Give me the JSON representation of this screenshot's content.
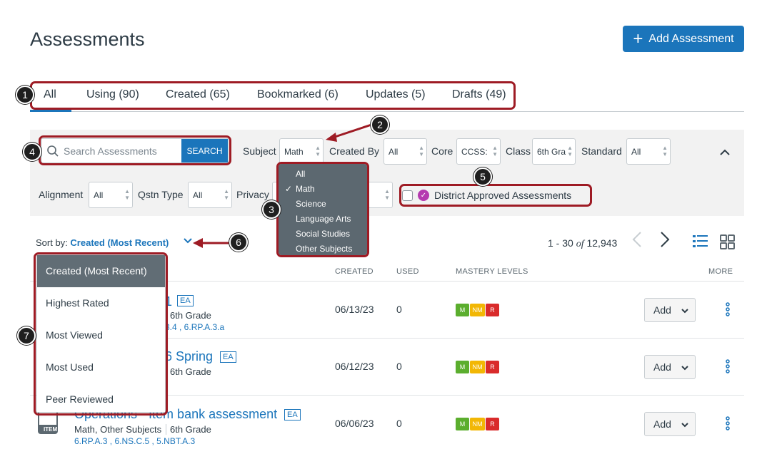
{
  "page": {
    "title": "Assessments",
    "add_button": "Add Assessment"
  },
  "tabs": [
    "All",
    "Using (90)",
    "Created (65)",
    "Bookmarked (6)",
    "Updates (5)",
    "Drafts (49)"
  ],
  "search": {
    "placeholder": "Search Assessments",
    "button": "SEARCH"
  },
  "filters": {
    "subject": {
      "label": "Subject",
      "value": "Math"
    },
    "created_by": {
      "label": "Created By",
      "value": "All"
    },
    "core": {
      "label": "Core",
      "value": "CCSS:"
    },
    "class": {
      "label": "Class",
      "value": "6th Gra"
    },
    "standard": {
      "label": "Standard",
      "value": "All"
    },
    "alignment": {
      "label": "Alignment",
      "value": "All"
    },
    "qstn_type": {
      "label": "Qstn Type",
      "value": "All"
    },
    "privacy": {
      "label": "Privacy"
    },
    "district": "District Approved Assessments"
  },
  "subject_menu": {
    "items": [
      "All",
      "Math",
      "Science",
      "Language Arts",
      "Social Studies",
      "Other Subjects"
    ],
    "selected": "Math"
  },
  "sort": {
    "label": "Sort by:",
    "value": "Created (Most Recent)",
    "options": [
      "Created (Most Recent)",
      "Highest Rated",
      "Most Viewed",
      "Most Used",
      "Peer Reviewed"
    ]
  },
  "pager": {
    "range": "1 - 30",
    "of": "of",
    "total": "12,943"
  },
  "columns": {
    "created": "CREATED",
    "used": "USED",
    "mastery": "MASTERY LEVELS",
    "more": "MORE"
  },
  "mastery_labels": {
    "m": "M",
    "nm": "NM",
    "r": "R"
  },
  "colors": {
    "accent": "#1b75bb",
    "callout_border": "#9e1b24",
    "m": "#5bae2e",
    "nm": "#f2b705",
    "r": "#d92b2b"
  },
  "rows": [
    {
      "title_tail": "1",
      "ea": "EA",
      "grade": "6th Grade",
      "standards_tail": "3.4 , 6.RP.A.3.a",
      "created": "06/13/23",
      "used": "0",
      "add": "Add"
    },
    {
      "title_tail": "6 Spring",
      "ea": "EA",
      "grade": "6th Grade",
      "created": "06/12/23",
      "used": "0",
      "add": "Add"
    },
    {
      "title_tail": "Operations - Item bank assessment",
      "ea": "EA",
      "subjects": "Math, Other Subjects",
      "grade": "6th Grade",
      "standards": "6.RP.A.3 , 6.NS.C.5 , 5.NBT.A.3",
      "icon_label": "ITEM",
      "created": "06/06/23",
      "used": "0",
      "add": "Add"
    }
  ],
  "callouts": [
    "1",
    "2",
    "3",
    "4",
    "5",
    "6",
    "7"
  ]
}
